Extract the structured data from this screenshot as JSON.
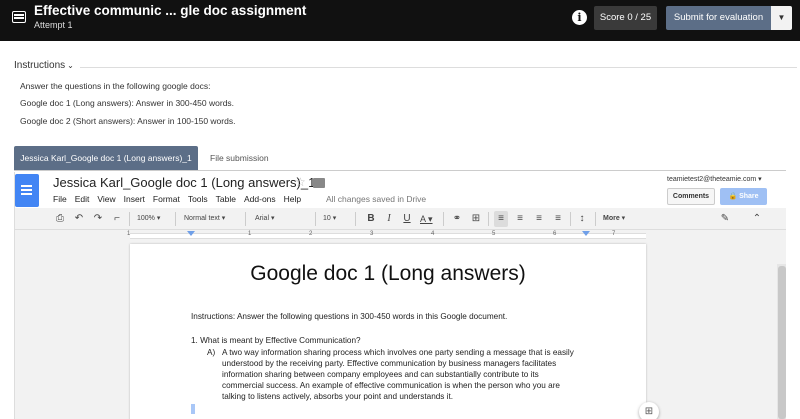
{
  "topbar": {
    "title": "Effective communic ... gle doc assignment",
    "subtitle": "Attempt 1",
    "info_glyph": "i",
    "score": "Score 0 / 25",
    "submit_label": "Submit for evaluation",
    "submit_caret": "▼"
  },
  "instructions": {
    "heading": "Instructions",
    "chevron": "⌄",
    "lines": [
      "Answer the questions in the following google docs:",
      "Google doc 1 (Long answers): Answer in 300-450 words.",
      "Google doc 2 (Short answers): Answer in 100-150 words."
    ]
  },
  "tabs": [
    {
      "label": "Jessica Karl_Google doc 1 (Long answers)_1"
    },
    {
      "label": "File submission"
    }
  ],
  "gdoc": {
    "title": "Jessica Karl_Google doc 1 (Long answers)_1",
    "star": "☆",
    "menu": [
      "File",
      "Edit",
      "View",
      "Insert",
      "Format",
      "Tools",
      "Table",
      "Add-ons",
      "Help"
    ],
    "saved_status": "All changes saved in Drive",
    "account": "teamietest2@theteamie.com ▾",
    "comments_label": "Comments",
    "share_label": "🔒 Share",
    "toolbar": {
      "zoom": "100% ▾",
      "style": "Normal text ▾",
      "font": "Arial ▾",
      "size": "10 ▾",
      "bold": "B",
      "italic": "I",
      "underline": "U",
      "text_color": "A ▾",
      "more": "More ▾"
    },
    "ruler_numbers": [
      "1",
      "1",
      "2",
      "3",
      "4",
      "5",
      "6",
      "7"
    ],
    "page": {
      "heading": "Google doc 1 (Long answers)",
      "instr_label": "Instructions:",
      "instr_text": " Answer the following questions in 300-450 words in this Google document.",
      "question": "1. What is meant by Effective Communication?",
      "answer_label": "A)",
      "answer_lines": [
        "A two way information sharing process which involves one party sending a message that is easily",
        "understood by the receiving party. Effective communication by business managers facilitates",
        "information sharing between company employees and can substantially contribute to its",
        "commercial success. An example of effective communication is when the person who you are",
        "talking to listens actively, absorbs your point and understands it."
      ]
    }
  }
}
